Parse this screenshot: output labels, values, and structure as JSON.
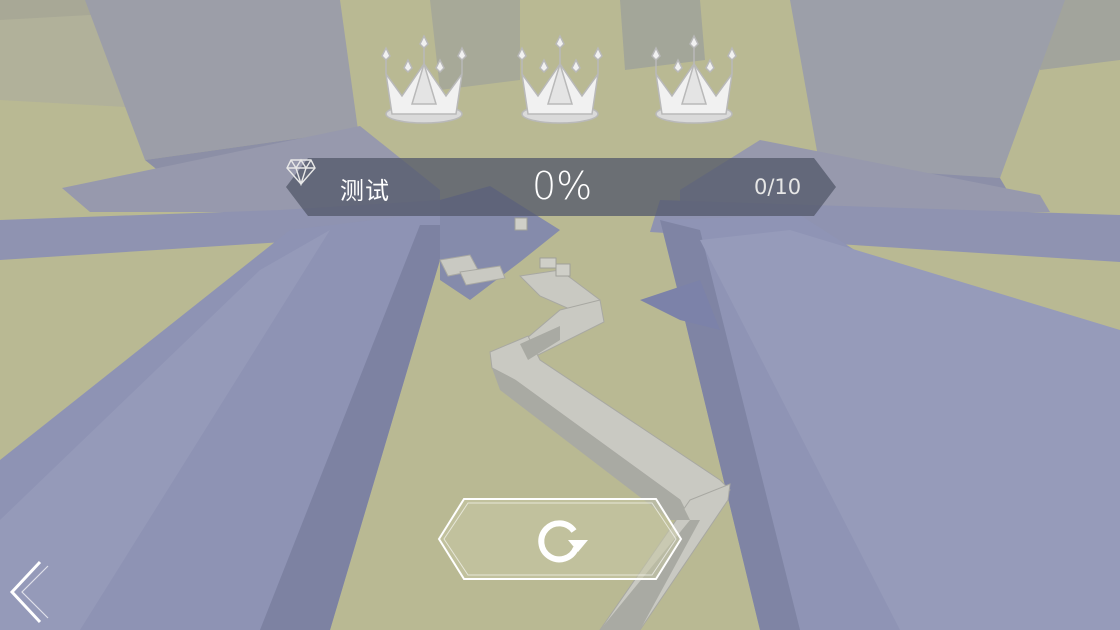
{
  "hud": {
    "level_name": "测试",
    "progress": "0%",
    "gem_count": "0/10"
  },
  "crowns": [
    {
      "name": "crown-1",
      "earned": false
    },
    {
      "name": "crown-2",
      "earned": false
    },
    {
      "name": "crown-3",
      "earned": false
    }
  ],
  "icons": {
    "restart": "restart-icon",
    "back": "back-chevron-icon",
    "gem": "diamond-icon",
    "crown": "crown-icon"
  },
  "colors": {
    "ground": "#b8b894",
    "walls": "#8d92b4",
    "path": "#c8c8c0",
    "hud_bar": "#5a5f6e",
    "ui_white": "#ffffff"
  }
}
